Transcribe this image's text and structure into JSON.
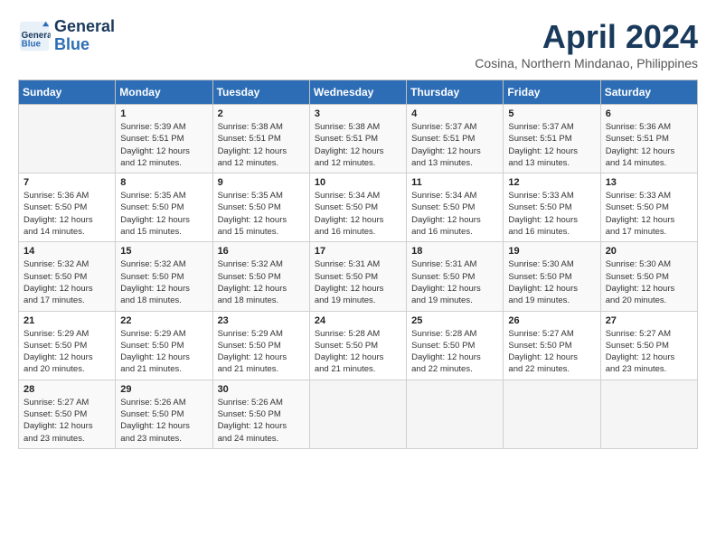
{
  "header": {
    "logo_line1": "General",
    "logo_line2": "Blue",
    "month_year": "April 2024",
    "location": "Cosina, Northern Mindanao, Philippines"
  },
  "weekdays": [
    "Sunday",
    "Monday",
    "Tuesday",
    "Wednesday",
    "Thursday",
    "Friday",
    "Saturday"
  ],
  "weeks": [
    [
      {
        "day": "",
        "info": ""
      },
      {
        "day": "1",
        "info": "Sunrise: 5:39 AM\nSunset: 5:51 PM\nDaylight: 12 hours\nand 12 minutes."
      },
      {
        "day": "2",
        "info": "Sunrise: 5:38 AM\nSunset: 5:51 PM\nDaylight: 12 hours\nand 12 minutes."
      },
      {
        "day": "3",
        "info": "Sunrise: 5:38 AM\nSunset: 5:51 PM\nDaylight: 12 hours\nand 12 minutes."
      },
      {
        "day": "4",
        "info": "Sunrise: 5:37 AM\nSunset: 5:51 PM\nDaylight: 12 hours\nand 13 minutes."
      },
      {
        "day": "5",
        "info": "Sunrise: 5:37 AM\nSunset: 5:51 PM\nDaylight: 12 hours\nand 13 minutes."
      },
      {
        "day": "6",
        "info": "Sunrise: 5:36 AM\nSunset: 5:51 PM\nDaylight: 12 hours\nand 14 minutes."
      }
    ],
    [
      {
        "day": "7",
        "info": "Sunrise: 5:36 AM\nSunset: 5:50 PM\nDaylight: 12 hours\nand 14 minutes."
      },
      {
        "day": "8",
        "info": "Sunrise: 5:35 AM\nSunset: 5:50 PM\nDaylight: 12 hours\nand 15 minutes."
      },
      {
        "day": "9",
        "info": "Sunrise: 5:35 AM\nSunset: 5:50 PM\nDaylight: 12 hours\nand 15 minutes."
      },
      {
        "day": "10",
        "info": "Sunrise: 5:34 AM\nSunset: 5:50 PM\nDaylight: 12 hours\nand 16 minutes."
      },
      {
        "day": "11",
        "info": "Sunrise: 5:34 AM\nSunset: 5:50 PM\nDaylight: 12 hours\nand 16 minutes."
      },
      {
        "day": "12",
        "info": "Sunrise: 5:33 AM\nSunset: 5:50 PM\nDaylight: 12 hours\nand 16 minutes."
      },
      {
        "day": "13",
        "info": "Sunrise: 5:33 AM\nSunset: 5:50 PM\nDaylight: 12 hours\nand 17 minutes."
      }
    ],
    [
      {
        "day": "14",
        "info": "Sunrise: 5:32 AM\nSunset: 5:50 PM\nDaylight: 12 hours\nand 17 minutes."
      },
      {
        "day": "15",
        "info": "Sunrise: 5:32 AM\nSunset: 5:50 PM\nDaylight: 12 hours\nand 18 minutes."
      },
      {
        "day": "16",
        "info": "Sunrise: 5:32 AM\nSunset: 5:50 PM\nDaylight: 12 hours\nand 18 minutes."
      },
      {
        "day": "17",
        "info": "Sunrise: 5:31 AM\nSunset: 5:50 PM\nDaylight: 12 hours\nand 19 minutes."
      },
      {
        "day": "18",
        "info": "Sunrise: 5:31 AM\nSunset: 5:50 PM\nDaylight: 12 hours\nand 19 minutes."
      },
      {
        "day": "19",
        "info": "Sunrise: 5:30 AM\nSunset: 5:50 PM\nDaylight: 12 hours\nand 19 minutes."
      },
      {
        "day": "20",
        "info": "Sunrise: 5:30 AM\nSunset: 5:50 PM\nDaylight: 12 hours\nand 20 minutes."
      }
    ],
    [
      {
        "day": "21",
        "info": "Sunrise: 5:29 AM\nSunset: 5:50 PM\nDaylight: 12 hours\nand 20 minutes."
      },
      {
        "day": "22",
        "info": "Sunrise: 5:29 AM\nSunset: 5:50 PM\nDaylight: 12 hours\nand 21 minutes."
      },
      {
        "day": "23",
        "info": "Sunrise: 5:29 AM\nSunset: 5:50 PM\nDaylight: 12 hours\nand 21 minutes."
      },
      {
        "day": "24",
        "info": "Sunrise: 5:28 AM\nSunset: 5:50 PM\nDaylight: 12 hours\nand 21 minutes."
      },
      {
        "day": "25",
        "info": "Sunrise: 5:28 AM\nSunset: 5:50 PM\nDaylight: 12 hours\nand 22 minutes."
      },
      {
        "day": "26",
        "info": "Sunrise: 5:27 AM\nSunset: 5:50 PM\nDaylight: 12 hours\nand 22 minutes."
      },
      {
        "day": "27",
        "info": "Sunrise: 5:27 AM\nSunset: 5:50 PM\nDaylight: 12 hours\nand 23 minutes."
      }
    ],
    [
      {
        "day": "28",
        "info": "Sunrise: 5:27 AM\nSunset: 5:50 PM\nDaylight: 12 hours\nand 23 minutes."
      },
      {
        "day": "29",
        "info": "Sunrise: 5:26 AM\nSunset: 5:50 PM\nDaylight: 12 hours\nand 23 minutes."
      },
      {
        "day": "30",
        "info": "Sunrise: 5:26 AM\nSunset: 5:50 PM\nDaylight: 12 hours\nand 24 minutes."
      },
      {
        "day": "",
        "info": ""
      },
      {
        "day": "",
        "info": ""
      },
      {
        "day": "",
        "info": ""
      },
      {
        "day": "",
        "info": ""
      }
    ]
  ]
}
